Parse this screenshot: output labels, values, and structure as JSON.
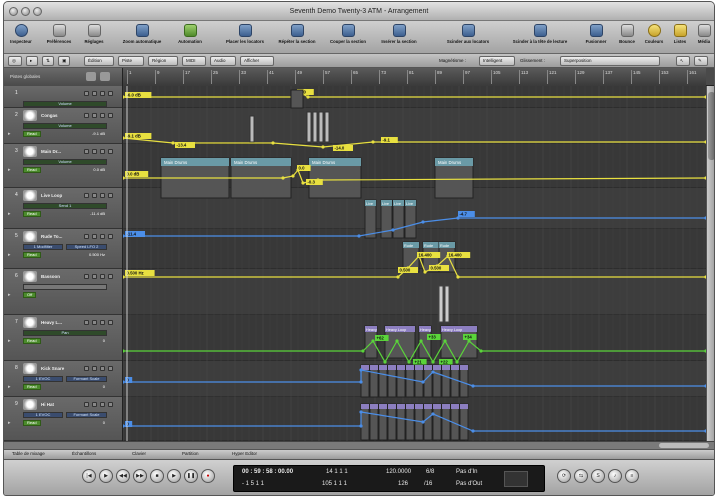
{
  "window": {
    "title": "Seventh Demo Twenty-3 ATM - Arrangement"
  },
  "toolbar": {
    "inspector": "Inspecteur",
    "prefs": "Préférences",
    "settings": "Réglages",
    "auto_zoom": "Zoom automatique",
    "automation": "Automation",
    "set_locators": "Placer les locators",
    "repeat_section": "Répéter la section",
    "cut_section": "Couper la section",
    "insert_section": "Insérer la section",
    "split_locators": "Scinder aux locators",
    "split_playhead": "Scinder à la tête de lecture",
    "merge": "Fusionner",
    "bounce": "Bounce",
    "colors": "Couleurs",
    "lists": "Listes",
    "media": "Média"
  },
  "menubar": {
    "edit": "Édition",
    "track": "Piste",
    "region": "Région",
    "midi": "MIDI",
    "audio": "Audio",
    "view": "Afficher",
    "snap_label": "Magnétisme :",
    "snap_value": "Intelligent",
    "drag_label": "Glissement :",
    "drag_value": "Superposition"
  },
  "ruler": {
    "global_tracks": "Pistes globales",
    "bars": [
      "1",
      "9",
      "17",
      "25",
      "33",
      "41",
      "49",
      "57",
      "65",
      "73",
      "81",
      "89",
      "97",
      "105",
      "113",
      "121",
      "129",
      "137",
      "145",
      "153",
      "161"
    ]
  },
  "tracks": [
    {
      "num": "1",
      "name": "",
      "param": "Volume",
      "mode": "Read",
      "value": "-6.0 dB"
    },
    {
      "num": "2",
      "name": "Congas",
      "param": "Volume",
      "mode": "Read",
      "value": "-9.1 dB"
    },
    {
      "num": "3",
      "name": "Main Dr...",
      "param": "Volume",
      "mode": "Read",
      "value": "0.0 dB"
    },
    {
      "num": "4",
      "name": "Live Loop",
      "param": "Send 1",
      "mode": "Read",
      "value": "-11.4 dB"
    },
    {
      "num": "5",
      "name": "Rude To...",
      "param": "1 Modfilter",
      "param2": "Speed LFO 2",
      "mode": "Read",
      "value": "0.500 Hz"
    },
    {
      "num": "6",
      "name": "Bassoon",
      "param": "",
      "mode": "Off",
      "value": ""
    },
    {
      "num": "7",
      "name": "Heavy L...",
      "param": "Pan",
      "mode": "Read",
      "value": "0"
    },
    {
      "num": "8",
      "name": "Kick Snare",
      "param": "1 EVOC",
      "param2": "Formant Scale",
      "mode": "Read",
      "value": "0"
    },
    {
      "num": "9",
      "name": "Hi Hat",
      "param": "1 EVOC",
      "param2": "Formant Scale",
      "mode": "Read",
      "value": "0"
    }
  ],
  "automation_labels": {
    "t1_a": "-6.0 dB",
    "t1_b": "-6.0",
    "t2_a": "-9.1 dB",
    "t2_b": "-13.4",
    "t2_c": "-14.0",
    "t2_d": "-9.1",
    "t3_a": "0.0 dB",
    "t3_b": "0.0",
    "t3_c": "-0.3",
    "t4_a": "-11.4",
    "t4_b": "-4.7",
    "t5_a": "0.500 Hz",
    "t5_b": "0.500",
    "t5_c": "16.400",
    "t5_d": "16.400",
    "t5_e": "0.500",
    "t7_a": "+62",
    "t7_b": "+21",
    "t7_c": "+22",
    "t7_d": "+33",
    "t7_e": "+34",
    "t8_a": "0",
    "t9_a": "0"
  },
  "regions": {
    "main_drums": "Main Drums",
    "live": "Live",
    "rude": "Rude",
    "heavy": "Heavy",
    "heavy_loop": "Heavy Loop"
  },
  "bottom_tabs": [
    "Table de mixage",
    "Échantillons",
    "Clavier",
    "Partition",
    "Hyper Editor"
  ],
  "transport": {
    "time_top": "00 : 59 : 58 : 00.00",
    "time_bottom": "-   1   5   1   1",
    "pos_top": "14   1   1   1",
    "pos_bottom": "105   1   1   1",
    "tempo": "120.0000",
    "division": "126",
    "sig_top": "6/8",
    "sig_bottom": "/16",
    "punch_in": "Pas d'In",
    "punch_out": "Pas d'Out"
  },
  "colors": {
    "automation_yellow": "#e8e040",
    "automation_blue": "#4b8ee8",
    "automation_green": "#5ad43a",
    "region_teal": "#6a9aa6",
    "region_purple": "#8c7ec0"
  }
}
